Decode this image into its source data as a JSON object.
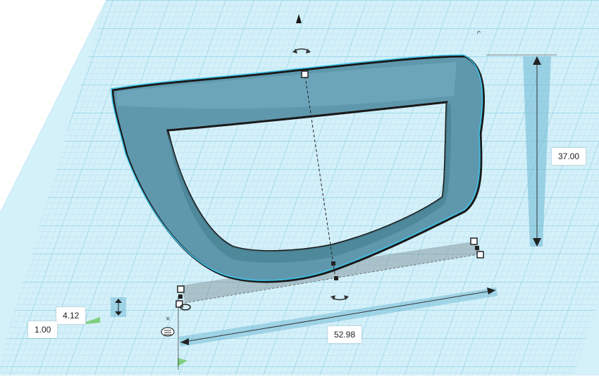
{
  "workplane": {
    "grid_color": "#8fd3ea",
    "background": "#c8ecf7"
  },
  "shape": {
    "fill_color": "#5f98ad",
    "outline_color": "#3cc6ec"
  },
  "dimensions": {
    "height": "37.00",
    "width": "52.98",
    "depth": "4.12",
    "elevation": "1.00"
  },
  "icons": {
    "top_cone": "cone-up-icon",
    "rotate_top": "rotate-arrow-icon",
    "rotate_bottom": "rotate-arrow-icon",
    "ruler_origin": "ruler-icon",
    "close_x": "close-icon"
  },
  "misc": {
    "close_glyph": "×"
  }
}
